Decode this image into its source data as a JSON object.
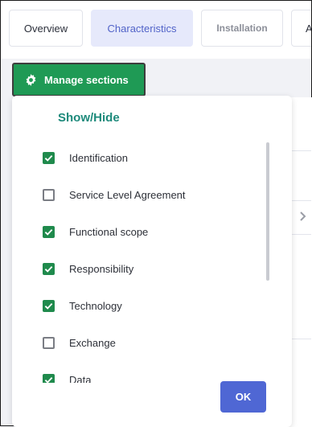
{
  "tabs": [
    {
      "label": "Overview",
      "state": "default"
    },
    {
      "label": "Characteristics",
      "state": "active"
    },
    {
      "label": "Installation",
      "state": "dimmed"
    },
    {
      "label": "A",
      "state": "truncated"
    }
  ],
  "manage_button": {
    "label": "Manage sections",
    "icon": "gear-icon"
  },
  "panel": {
    "title": "Show/Hide",
    "ok_label": "OK",
    "items": [
      {
        "label": "Identification",
        "checked": true
      },
      {
        "label": "Service Level Agreement",
        "checked": false
      },
      {
        "label": "Functional scope",
        "checked": true
      },
      {
        "label": "Responsibility",
        "checked": true
      },
      {
        "label": "Technology",
        "checked": true
      },
      {
        "label": "Exchange",
        "checked": false
      },
      {
        "label": "Data",
        "checked": true
      }
    ]
  },
  "colors": {
    "primary_green": "#1f9a55",
    "checkbox_green": "#1f8a4c",
    "title_teal": "#1d8a7b",
    "ok_blue": "#4f67d4",
    "active_tab_bg": "#e6e9fb",
    "active_tab_text": "#5163c8"
  }
}
